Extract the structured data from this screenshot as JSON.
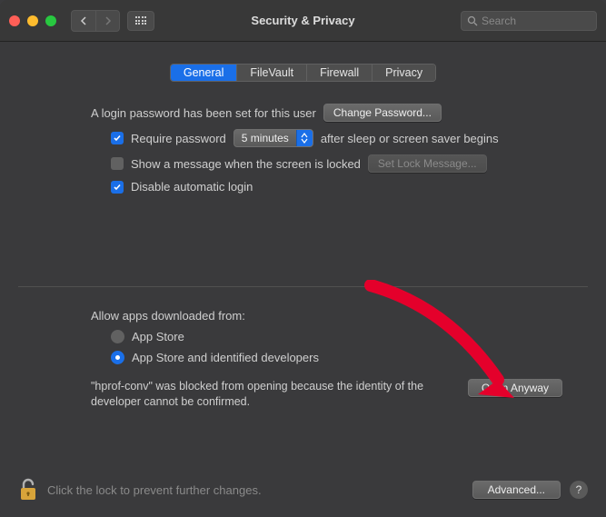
{
  "window": {
    "title": "Security & Privacy"
  },
  "search": {
    "placeholder": "Search"
  },
  "tabs": {
    "general": "General",
    "filevault": "FileVault",
    "firewall": "Firewall",
    "privacy": "Privacy",
    "active": "general"
  },
  "login": {
    "password_set_text": "A login password has been set for this user",
    "change_password_btn": "Change Password...",
    "require_password_label": "Require password",
    "require_password_checked": true,
    "delay_value": "5 minutes",
    "after_sleep_text": "after sleep or screen saver begins",
    "show_message_label": "Show a message when the screen is locked",
    "show_message_checked": false,
    "set_lock_msg_btn": "Set Lock Message...",
    "disable_auto_login_label": "Disable automatic login",
    "disable_auto_login_checked": true
  },
  "gatekeeper": {
    "heading": "Allow apps downloaded from:",
    "opt_appstore": "App Store",
    "opt_identified": "App Store and identified developers",
    "selected": "identified",
    "blocked_msg": "\"hprof-conv\" was blocked from opening because the identity of the developer cannot be confirmed.",
    "open_anyway_btn": "Open Anyway"
  },
  "footer": {
    "lock_text": "Click the lock to prevent further changes.",
    "advanced_btn": "Advanced...",
    "help": "?"
  }
}
